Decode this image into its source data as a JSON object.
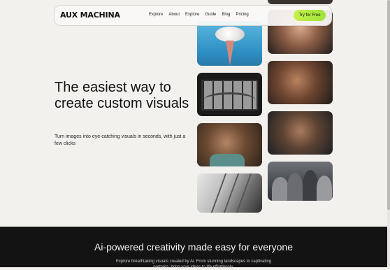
{
  "nav": {
    "logo": "AUX MACHINA",
    "links": [
      "Explore",
      "About",
      "Explore",
      "Guide",
      "Blog",
      "Pricing"
    ],
    "cta": "Try for Free"
  },
  "hero": {
    "title": "The easiest way to create custom visuals",
    "subtitle": "Turn images into eye-catching visuals in seconds, with just a few clicks"
  },
  "section2": {
    "title": "Ai-powered creativity made easy for everyone",
    "text": "Explore breathtaking visuals created by Ai. From stunning landscapes to captivating portraits, bring your ideas to life effortlessly."
  },
  "colors": {
    "background": "#f3f1ee",
    "cta_accent": "#b6ec42",
    "dark_section": "#131313"
  },
  "gallery": {
    "images": [
      "cloud-cone-image",
      "bridge-window-image",
      "man-portrait-image",
      "architecture-image",
      "face-closeup-image",
      "elder-portrait-image",
      "man-blue-eyes-image",
      "crowd-phone-image"
    ]
  }
}
